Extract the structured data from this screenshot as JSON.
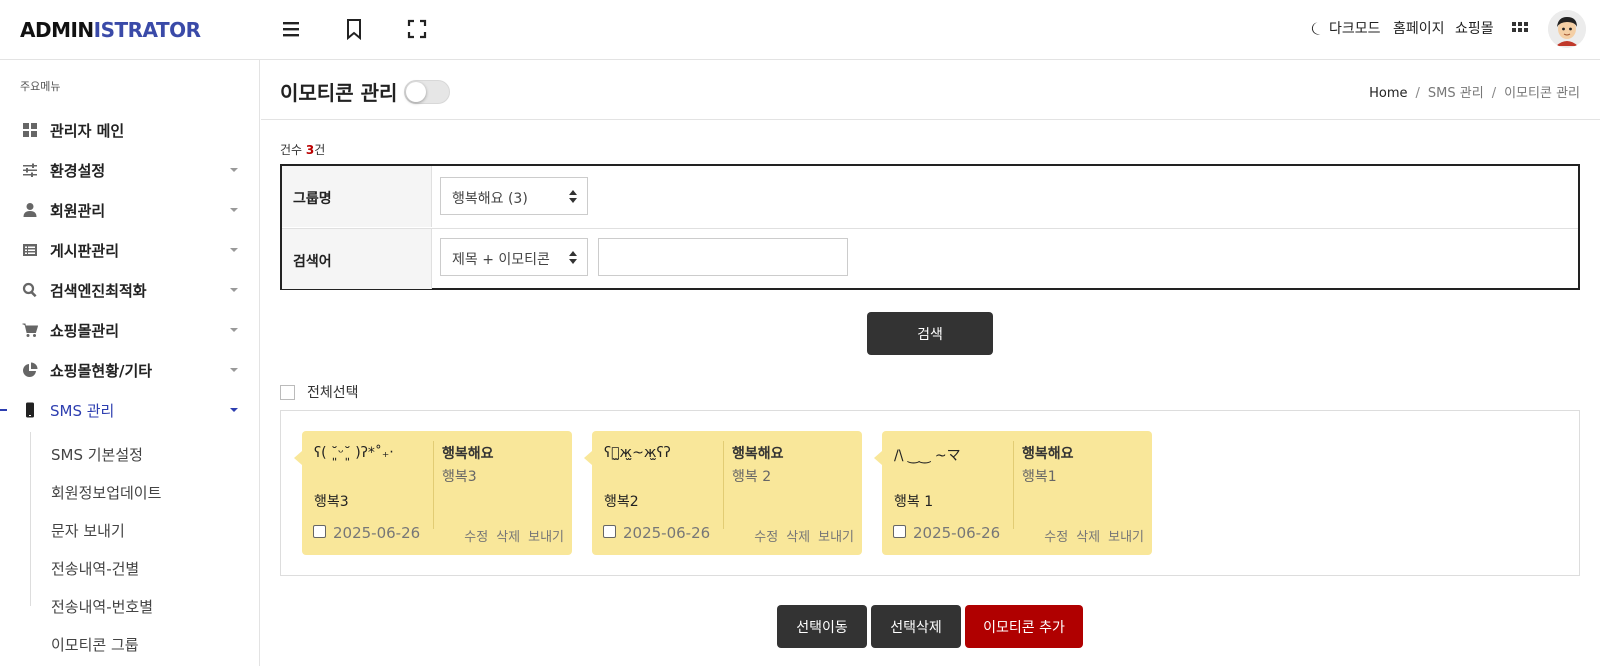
{
  "brand": {
    "part1": "ADMIN",
    "part2": "ISTRATOR"
  },
  "topbar": {
    "dark_mode": "다크모드",
    "homepage": "홈페이지",
    "shop": "쇼핑몰"
  },
  "sidebar": {
    "section": "주요메뉴",
    "items": [
      {
        "label": "관리자 메인",
        "icon": "dashboard-icon"
      },
      {
        "label": "환경설정",
        "icon": "sliders-icon"
      },
      {
        "label": "회원관리",
        "icon": "user-icon"
      },
      {
        "label": "게시판관리",
        "icon": "list-icon"
      },
      {
        "label": "검색엔진최적화",
        "icon": "search-icon"
      },
      {
        "label": "쇼핑몰관리",
        "icon": "cart-icon"
      },
      {
        "label": "쇼핑몰현황/기타",
        "icon": "pie-chart-icon"
      },
      {
        "label": "SMS 관리",
        "icon": "mobile-icon"
      }
    ],
    "sub_items": [
      "SMS 기본설정",
      "회원정보업데이트",
      "문자 보내기",
      "전송내역-건별",
      "전송내역-번호별",
      "이모티콘 그룹"
    ]
  },
  "page": {
    "title": "이모티콘 관리"
  },
  "breadcrumb": {
    "home": "Home",
    "sep": "/",
    "level1": "SMS 관리",
    "level2": "이모티콘 관리"
  },
  "count": {
    "prefix": "건수 ",
    "value": "3",
    "suffix": "건"
  },
  "filter": {
    "group_label": "그룹명",
    "group_value": "행복해요 (3)",
    "search_label": "검색어",
    "search_field": "제목 + 이모티콘",
    "search_value": ""
  },
  "buttons": {
    "search": "검색",
    "move": "선택이동",
    "delete": "선택삭제",
    "add": "이모티콘 추가"
  },
  "select_all": "전체선택",
  "cards": [
    {
      "emoticon": "ʕ( ˘͈ᵕ˘͈ )ʔ*˚₊‧",
      "name": "행복3",
      "group": "행복해요",
      "group_name": "행복3",
      "date": "2025-06-26",
      "edit": "수정",
      "delete": "삭제",
      "send": "보내기"
    },
    {
      "emoticon": "ʕっ̫ж̫~ж̫ʕʔ",
      "name": "행복2",
      "group": "행복해요",
      "group_name": "행복 2",
      "date": "2025-06-26",
      "edit": "수정",
      "delete": "삭제",
      "send": "보내기"
    },
    {
      "emoticon": "/\\ ‿‿ ~マ",
      "name": "행복 1",
      "group": "행복해요",
      "group_name": "행복1",
      "date": "2025-06-26",
      "edit": "수정",
      "delete": "삭제",
      "send": "보내기"
    }
  ],
  "colors": {
    "brand_blue": "#3a4aa8",
    "active_menu": "#2d3eb0",
    "count_red": "#b00000",
    "add_button": "#b00000",
    "dark_button": "#333333",
    "card_bg": "#f9e79a"
  }
}
